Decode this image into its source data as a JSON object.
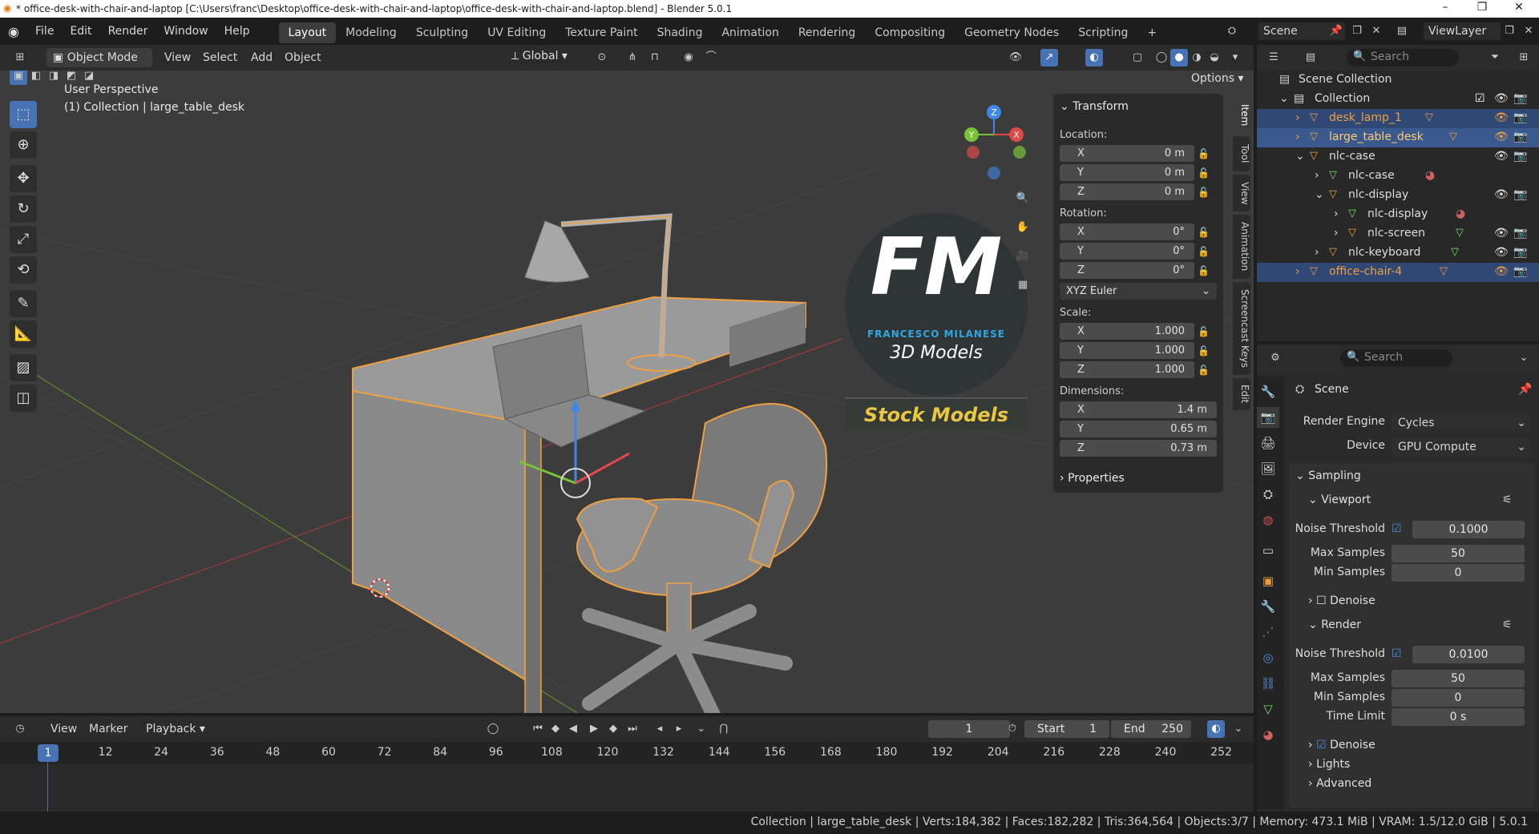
{
  "window": {
    "title": "* office-desk-with-chair-and-laptop [C:\\Users\\franc\\Desktop\\office-desk-with-chair-and-laptop\\office-desk-with-chair-and-laptop.blend] - Blender 5.0.1"
  },
  "menu": [
    "File",
    "Edit",
    "Render",
    "Window",
    "Help"
  ],
  "workspaces": [
    "Layout",
    "Modeling",
    "Sculpting",
    "UV Editing",
    "Texture Paint",
    "Shading",
    "Animation",
    "Rendering",
    "Compositing",
    "Geometry Nodes",
    "Scripting"
  ],
  "workspace_add": "+",
  "scene_name": "Scene",
  "view_layer": "ViewLayer",
  "viewport_header": {
    "mode": "Object Mode",
    "menus": [
      "View",
      "Select",
      "Add",
      "Object"
    ],
    "orientation": "Global",
    "options": "Options"
  },
  "viewport": {
    "perspective": "User Perspective",
    "context": "(1) Collection | large_table_desk",
    "logo_letters": "FM",
    "logo_name": "FRANCESCO MILANESE",
    "logo_sub": "3D Models",
    "stock_label": "Stock Models"
  },
  "npanel": {
    "transform_title": "Transform",
    "location_label": "Location:",
    "location": [
      {
        "axis": "X",
        "value": "0 m"
      },
      {
        "axis": "Y",
        "value": "0 m"
      },
      {
        "axis": "Z",
        "value": "0 m"
      }
    ],
    "rotation_label": "Rotation:",
    "rotation": [
      {
        "axis": "X",
        "value": "0°"
      },
      {
        "axis": "Y",
        "value": "0°"
      },
      {
        "axis": "Z",
        "value": "0°"
      }
    ],
    "rotation_mode": "XYZ Euler",
    "scale_label": "Scale:",
    "scale": [
      {
        "axis": "X",
        "value": "1.000"
      },
      {
        "axis": "Y",
        "value": "1.000"
      },
      {
        "axis": "Z",
        "value": "1.000"
      }
    ],
    "dimensions_label": "Dimensions:",
    "dimensions": [
      {
        "axis": "X",
        "value": "1.4 m"
      },
      {
        "axis": "Y",
        "value": "0.65 m"
      },
      {
        "axis": "Z",
        "value": "0.73 m"
      }
    ],
    "properties_title": "Properties",
    "tabs": [
      "Item",
      "Tool",
      "View",
      "Animation",
      "Screencast Keys",
      "Edit"
    ]
  },
  "outliner": {
    "search_placeholder": "Search",
    "scene_collection": "Scene Collection",
    "rows": [
      {
        "name": "Collection"
      },
      {
        "name": "desk_lamp_1"
      },
      {
        "name": "large_table_desk"
      },
      {
        "name": "nlc-case"
      },
      {
        "name": "nlc-case"
      },
      {
        "name": "nlc-display"
      },
      {
        "name": "nlc-display"
      },
      {
        "name": "nlc-screen"
      },
      {
        "name": "nlc-keyboard"
      },
      {
        "name": "office-chair-4"
      }
    ]
  },
  "properties": {
    "search_placeholder": "Search",
    "scene": "Scene",
    "render_engine_label": "Render Engine",
    "render_engine": "Cycles",
    "device_label": "Device",
    "device": "GPU Compute",
    "sampling": "Sampling",
    "viewport_section": "Viewport",
    "noise_threshold_label": "Noise Threshold",
    "vp_noise_threshold": "0.1000",
    "max_samples_label": "Max Samples",
    "vp_max_samples": "50",
    "min_samples_label": "Min Samples",
    "vp_min_samples": "0",
    "denoise_label": "Denoise",
    "render_section": "Render",
    "r_noise_threshold": "0.0100",
    "r_max_samples": "50",
    "r_min_samples": "0",
    "time_limit_label": "Time Limit",
    "r_time_limit": "0 s",
    "lights": "Lights",
    "advanced": "Advanced"
  },
  "timeline": {
    "menus": [
      "View",
      "Marker",
      "Playback"
    ],
    "current_frame": "1",
    "start_label": "Start",
    "start": "1",
    "end_label": "End",
    "end": "250",
    "ticks": [
      "1",
      "12",
      "24",
      "36",
      "48",
      "60",
      "72",
      "84",
      "96",
      "108",
      "120",
      "132",
      "144",
      "156",
      "168",
      "180",
      "192",
      "204",
      "216",
      "228",
      "240",
      "252"
    ]
  },
  "status": {
    "collection": "Collection",
    "object": "large_table_desk",
    "verts": "Verts:184,382",
    "faces": "Faces:182,282",
    "tris": "Tris:364,564",
    "objects": "Objects:3/7",
    "memory": "Memory: 473.1 MiB",
    "vram": "VRAM: 1.5/12.0 GiB",
    "version": "5.0.1"
  },
  "colors": {
    "selection_orange": "#f0a040",
    "active_blue": "#4772b3",
    "logo_blue": "#2fa8e0"
  }
}
